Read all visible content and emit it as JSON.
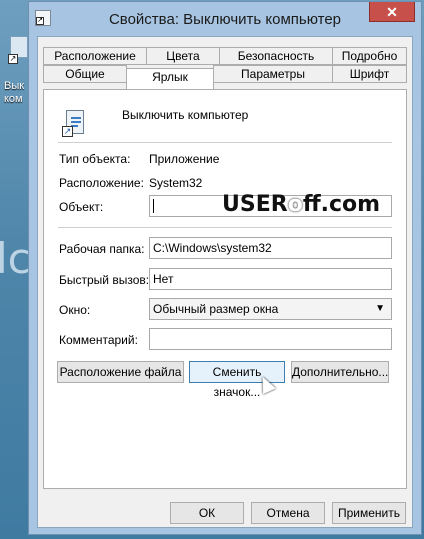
{
  "window": {
    "title": "Свойства: Выключить компьютер",
    "close_glyph": "✕"
  },
  "desktop": {
    "icon_label_line1": "Вык",
    "icon_label_line2": "ком",
    "side_text": "lc"
  },
  "tabs_row1": [
    "Расположение",
    "Цвета",
    "Безопасность",
    "Подробно"
  ],
  "tabs_row2": [
    "Общие",
    "Ярлык",
    "Параметры",
    "Шрифт"
  ],
  "active_tab": "Ярлык",
  "shortcut": {
    "name": "Выключить компьютер",
    "type_label": "Тип объекта:",
    "type_value": "Приложение",
    "location_label": "Расположение:",
    "location_value": "System32",
    "object_label": "Объект:",
    "object_value": "",
    "workdir_label": "Рабочая папка:",
    "workdir_value": "C:\\Windows\\system32",
    "hotkey_label": "Быстрый вызов:",
    "hotkey_value": "Нет",
    "window_label": "Окно:",
    "window_value": "Обычный размер окна",
    "comment_label": "Комментарий:",
    "comment_value": ""
  },
  "buttons": {
    "file_location": "Расположение файла",
    "change_icon": "Сменить значок...",
    "advanced": "Дополнительно...",
    "ok": "ОК",
    "cancel": "Отмена",
    "apply": "Применить"
  },
  "watermark": {
    "part1": "USER",
    "part2": "o",
    "part3": "ff.com"
  }
}
